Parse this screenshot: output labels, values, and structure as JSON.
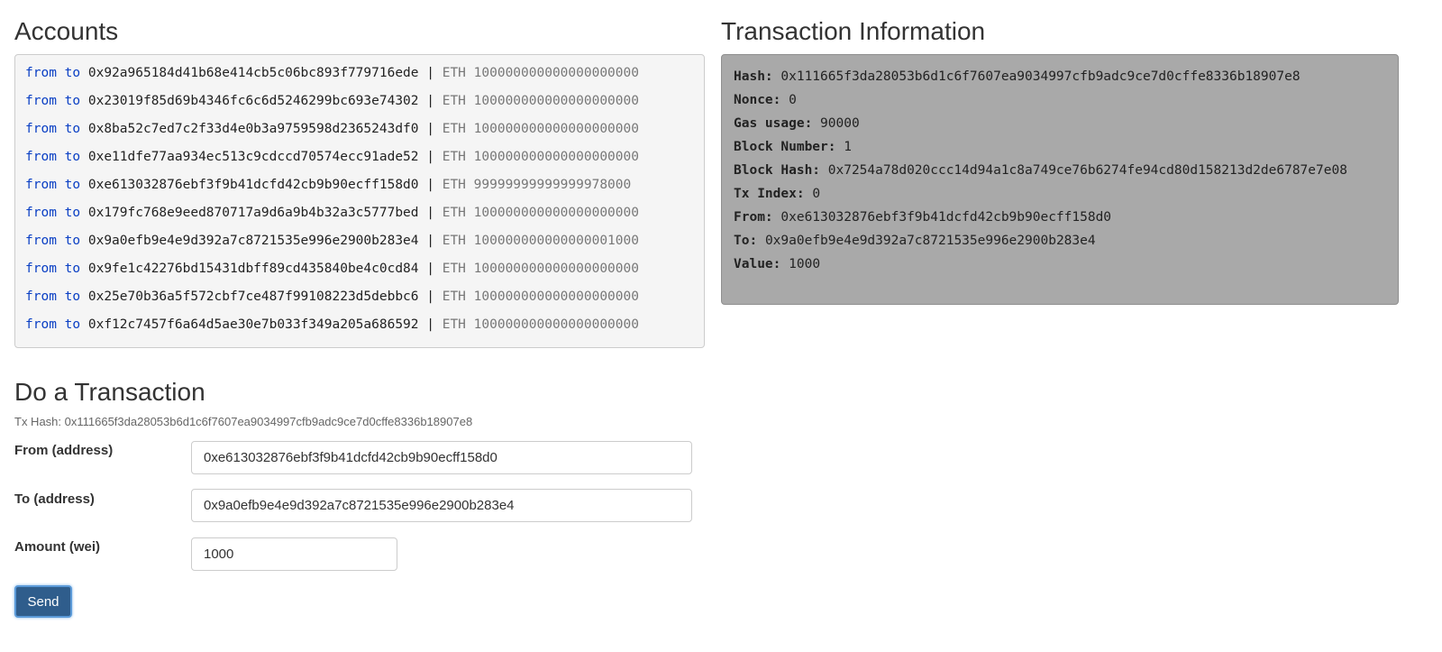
{
  "accounts": {
    "title": "Accounts",
    "from_label": "from",
    "to_label": "to",
    "separator": "|",
    "currency": "ETH",
    "rows": [
      {
        "address": "0x92a965184d41b68e414cb5c06bc893f779716ede",
        "balance": "100000000000000000000"
      },
      {
        "address": "0x23019f85d69b4346fc6c6d5246299bc693e74302",
        "balance": "100000000000000000000"
      },
      {
        "address": "0x8ba52c7ed7c2f33d4e0b3a9759598d2365243df0",
        "balance": "100000000000000000000"
      },
      {
        "address": "0xe11dfe77aa934ec513c9cdccd70574ecc91ade52",
        "balance": "100000000000000000000"
      },
      {
        "address": "0xe613032876ebf3f9b41dcfd42cb9b90ecff158d0",
        "balance": "99999999999999978000"
      },
      {
        "address": "0x179fc768e9eed870717a9d6a9b4b32a3c5777bed",
        "balance": "100000000000000000000"
      },
      {
        "address": "0x9a0efb9e4e9d392a7c8721535e996e2900b283e4",
        "balance": "100000000000000001000"
      },
      {
        "address": "0x9fe1c42276bd15431dbff89cd435840be4c0cd84",
        "balance": "100000000000000000000"
      },
      {
        "address": "0x25e70b36a5f572cbf7ce487f99108223d5debbc6",
        "balance": "100000000000000000000"
      },
      {
        "address": "0xf12c7457f6a64d5ae30e7b033f349a205a686592",
        "balance": "100000000000000000000"
      }
    ]
  },
  "tx_info": {
    "title": "Transaction Information",
    "fields": [
      {
        "label": "Hash:",
        "value": "0x111665f3da28053b6d1c6f7607ea9034997cfb9adc9ce7d0cffe8336b18907e8"
      },
      {
        "label": "Nonce:",
        "value": "0"
      },
      {
        "label": "Gas usage:",
        "value": "90000"
      },
      {
        "label": "Block Number:",
        "value": "1"
      },
      {
        "label": "Block Hash:",
        "value": "0x7254a78d020ccc14d94a1c8a749ce76b6274fe94cd80d158213d2de6787e7e08"
      },
      {
        "label": "Tx Index:",
        "value": "0"
      },
      {
        "label": "From:",
        "value": "0xe613032876ebf3f9b41dcfd42cb9b90ecff158d0"
      },
      {
        "label": "To:",
        "value": "0x9a0efb9e4e9d392a7c8721535e996e2900b283e4"
      },
      {
        "label": "Value:",
        "value": "1000"
      }
    ]
  },
  "transaction_form": {
    "title": "Do a Transaction",
    "tx_hash_text": "Tx Hash: 0x111665f3da28053b6d1c6f7607ea9034997cfb9adc9ce7d0cffe8336b18907e8",
    "from_label": "From (address)",
    "from_value": "0xe613032876ebf3f9b41dcfd42cb9b90ecff158d0",
    "to_label": "To (address)",
    "to_value": "0x9a0efb9e4e9d392a7c8721535e996e2900b283e4",
    "amount_label": "Amount (wei)",
    "amount_value": "1000",
    "send_label": "Send"
  }
}
